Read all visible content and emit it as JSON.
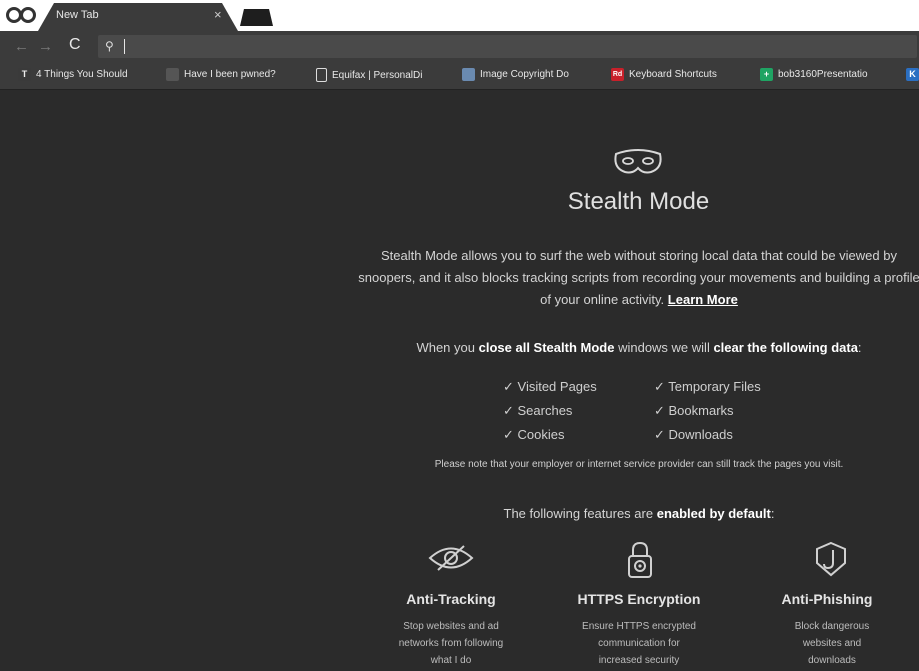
{
  "tab": {
    "title": "New Tab",
    "close_glyph": "×"
  },
  "toolbar": {
    "back_glyph": "←",
    "forward_glyph": "→",
    "reload_glyph": "C",
    "search_glyph": "⚲"
  },
  "bookmarks": [
    {
      "label": "4 Things You Should",
      "icon": "nyt-icon",
      "icon_text": "T",
      "color": "#3a3a3a"
    },
    {
      "label": "Have I been pwned?",
      "icon": "globe-icon",
      "icon_text": "",
      "color": "#555555"
    },
    {
      "label": "Equifax | PersonalDi",
      "icon": "page-icon",
      "icon_text": "",
      "color": "#3b3b3b"
    },
    {
      "label": "Image Copyright Do",
      "icon": "image-icon",
      "icon_text": "",
      "color": "#6a8ab0"
    },
    {
      "label": "Keyboard Shortcuts",
      "icon": "red-badge-icon",
      "icon_text": "Rd",
      "color": "#c8202a"
    },
    {
      "label": "bob3160Presentatio",
      "icon": "sheets-icon",
      "icon_text": "+",
      "color": "#1fa463"
    },
    {
      "label": "K",
      "icon": "blue-icon",
      "icon_text": "K",
      "color": "#2b6fc2"
    }
  ],
  "main": {
    "title": "Stealth Mode",
    "description": "Stealth Mode allows you to surf the web without storing local data that could be viewed by snoopers, and it also blocks tracking scripts from recording your movements and building a profile of your online activity.",
    "learn_more": "Learn More",
    "clear_prefix": "When you",
    "clear_bold1": "close all Stealth Mode",
    "clear_mid": "windows we will",
    "clear_bold2": "clear the following data",
    "clear_suffix": ":",
    "data_left": [
      "✓ Visited Pages",
      "✓ Searches",
      "✓ Cookies"
    ],
    "data_right": [
      "✓ Temporary Files",
      "✓ Bookmarks",
      "✓ Downloads"
    ],
    "note": "Please note that your employer or internet service provider can still track the pages you visit.",
    "features_prefix": "The following features are",
    "features_bold": "enabled by default",
    "features_suffix": ":",
    "features": [
      {
        "title": "Anti-Tracking",
        "desc": [
          "Stop websites and ad",
          "networks from following",
          "what I do"
        ]
      },
      {
        "title": "HTTPS Encryption",
        "desc": [
          "Ensure HTTPS encrypted",
          "communication for",
          "increased security"
        ]
      },
      {
        "title": "Anti-Phishing",
        "desc": [
          "Block dangerous",
          "websites and",
          "downloads"
        ]
      }
    ]
  }
}
